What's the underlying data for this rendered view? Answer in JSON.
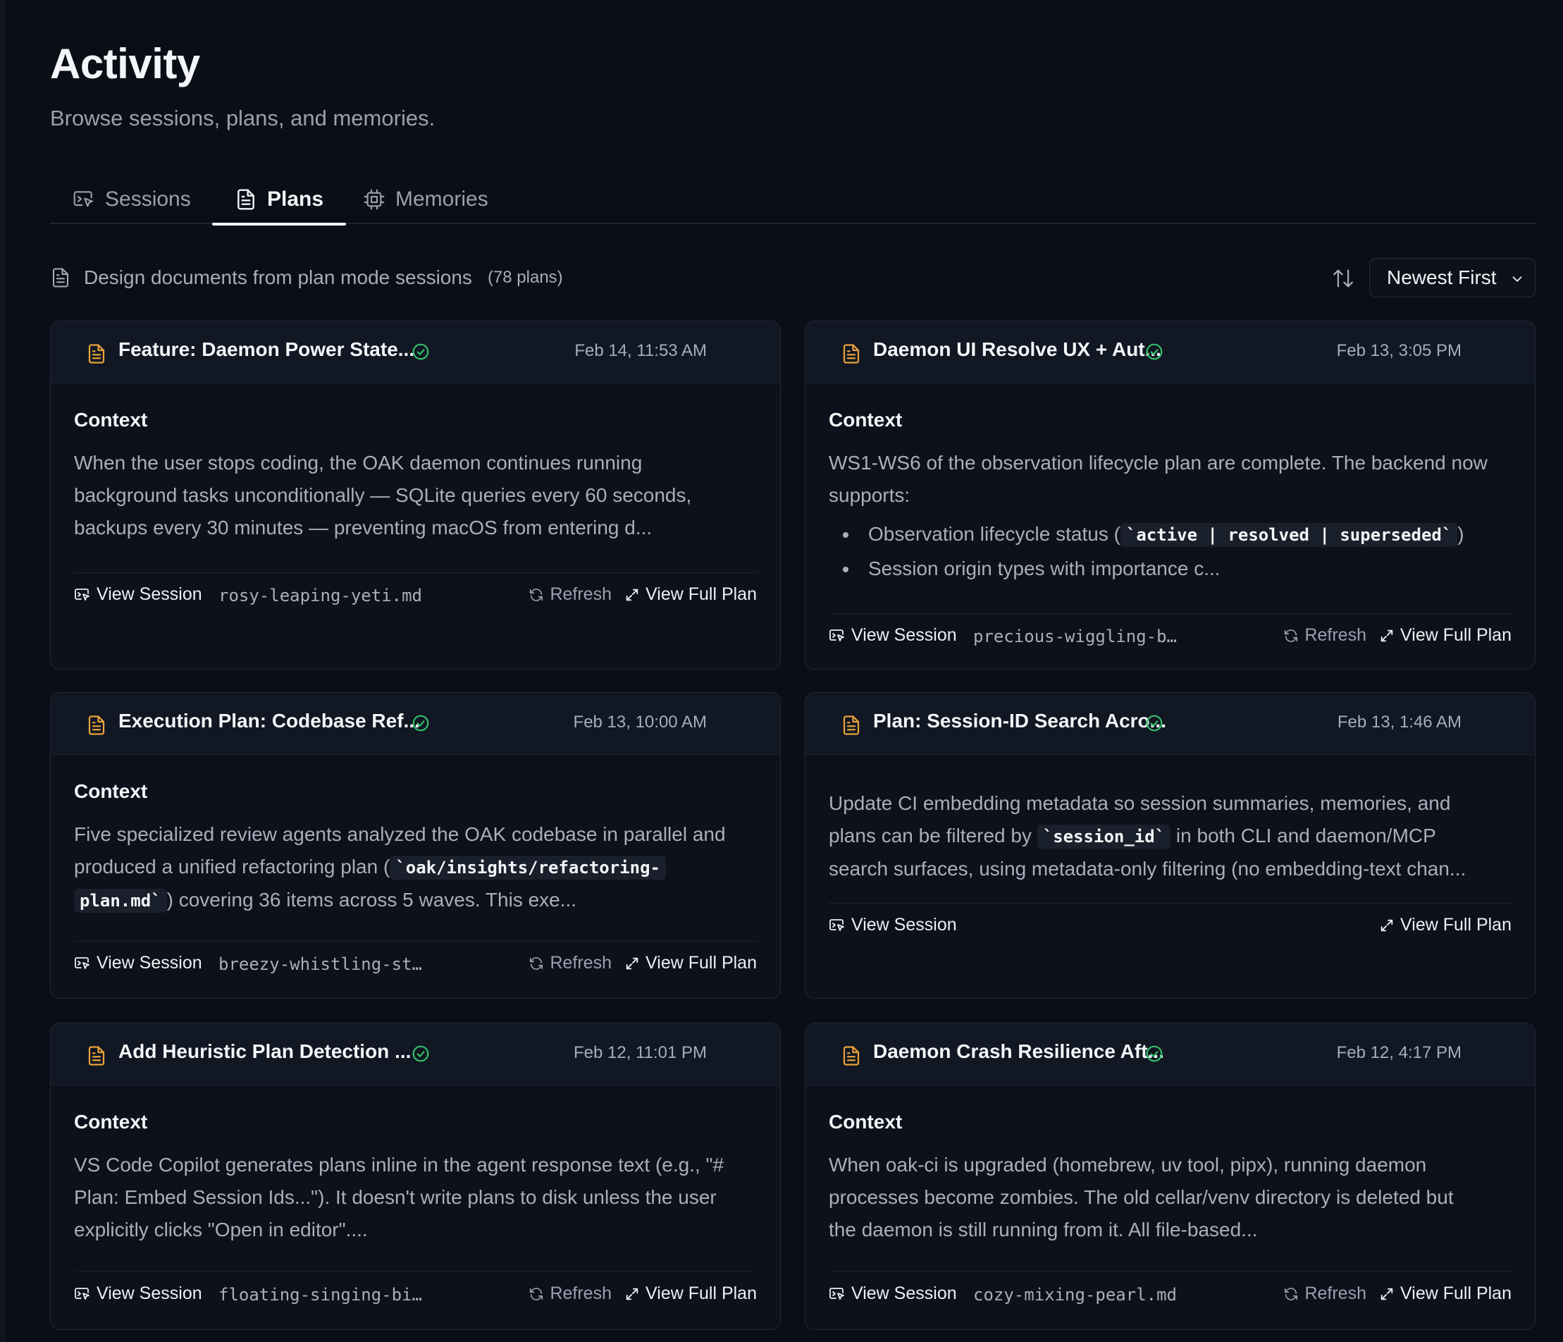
{
  "header": {
    "title": "Activity",
    "subtitle": "Browse sessions, plans, and memories."
  },
  "tabs": [
    {
      "label": "Sessions",
      "icon": "sessions-icon",
      "active": false
    },
    {
      "label": "Plans",
      "icon": "document-icon",
      "active": true
    },
    {
      "label": "Memories",
      "icon": "chip-icon",
      "active": false
    }
  ],
  "toolbar": {
    "description": "Design documents from plan mode sessions",
    "count": "(78 plans)",
    "sort_label": "Newest First"
  },
  "colors": {
    "doc_icon": "#e8a23a",
    "check_icon": "#34c26b",
    "background": "#0a0e17",
    "card": "#0c111b"
  },
  "actions": {
    "view_session": "View Session",
    "refresh": "Refresh",
    "view_full_plan": "View Full Plan"
  },
  "cards": [
    {
      "title": "Feature: Daemon Power State...",
      "date": "Feb 14, 11:53 AM",
      "heading": "Context",
      "text_lines": [
        "When the user stops coding, the OAK daemon continues running",
        "background tasks unconditionally — SQLite queries every 60 seconds,",
        "backups every 30 minutes — preventing macOS from entering d..."
      ],
      "filename": "rosy-leaping-yeti.md"
    },
    {
      "title": "Daemon UI Resolve UX + Aut...",
      "date": "Feb 13, 3:05 PM",
      "heading": "Context",
      "text_lines": [
        "WS1-WS6 of the observation lifecycle plan are complete. The backend now",
        "supports:"
      ],
      "bullet_1_prefix": "Observation lifecycle status (",
      "bullet_1_code": "`active | resolved | superseded`",
      "bullet_1_suffix": ")",
      "bullet_2": "Session origin types with importance c...",
      "filename": "precious-wiggling-b…"
    },
    {
      "title": "Execution Plan: Codebase Ref...",
      "date": "Feb 13, 10:00 AM",
      "heading": "Context",
      "line_1": "Five specialized review agents analyzed the OAK codebase in parallel and",
      "line_2_prefix": "produced a unified refactoring plan (",
      "line_2_code": "`oak/insights/refactoring-",
      "line_3_code": "plan.md`",
      "line_3_suffix": ") covering 36 items across 5 waves. This exe...",
      "filename": "breezy-whistling-st…"
    },
    {
      "title": "Plan: Session-ID Search Acro...",
      "date": "Feb 13, 1:46 AM",
      "line_1": "Update CI embedding metadata so session summaries, memories, and",
      "line_2_prefix": "plans can be filtered by",
      "line_2_code": "`session_id`",
      "line_2_suffix": "in both CLI and daemon/MCP",
      "line_3": "search surfaces, using metadata-only filtering (no embedding-text chan..."
    },
    {
      "title": "Add Heuristic Plan Detection ...",
      "date": "Feb 12, 11:01 PM",
      "heading": "Context",
      "text_lines": [
        "VS Code Copilot generates plans inline in the agent response text (e.g., \"#",
        "Plan: Embed Session Ids...\"). It doesn't write plans to disk unless the user",
        "explicitly clicks \"Open in editor\"...."
      ],
      "filename": "floating-singing-bi…"
    },
    {
      "title": "Daemon Crash Resilience Aft...",
      "date": "Feb 12, 4:17 PM",
      "heading": "Context",
      "text_lines": [
        "When oak-ci is upgraded (homebrew, uv tool, pipx), running daemon",
        "processes become zombies. The old cellar/venv directory is deleted but",
        "the daemon is still running from it. All file-based..."
      ],
      "filename": "cozy-mixing-pearl.md"
    }
  ]
}
